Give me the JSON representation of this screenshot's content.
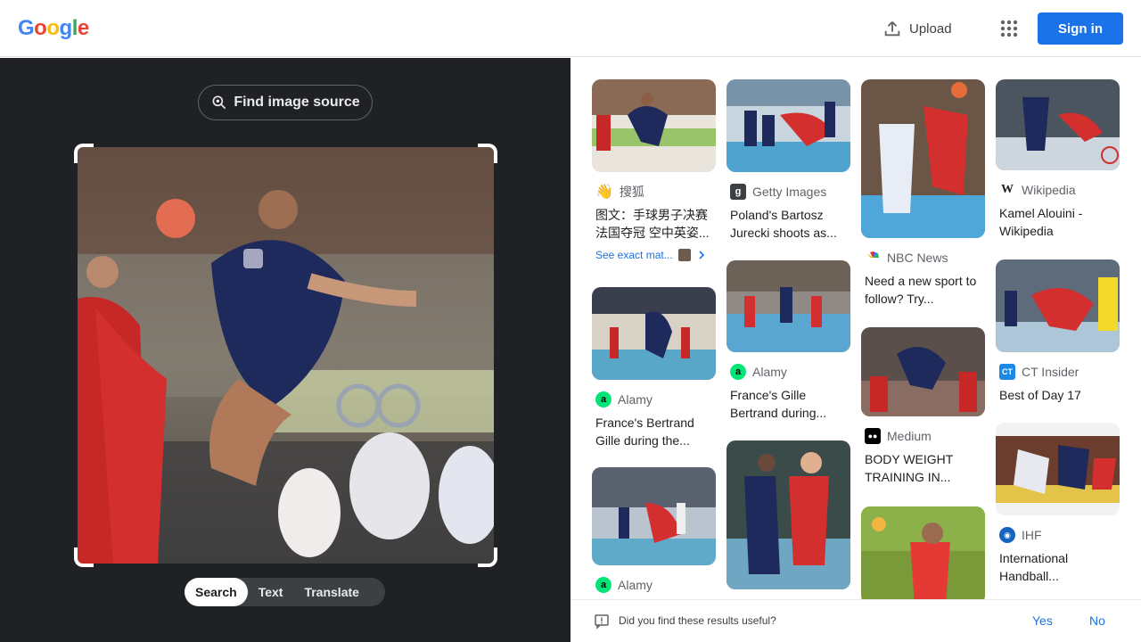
{
  "header": {
    "logo_letters": [
      "G",
      "o",
      "o",
      "g",
      "l",
      "e"
    ],
    "logo_colors": [
      "#4285f4",
      "#ea4335",
      "#fbbc05",
      "#4285f4",
      "#34a853",
      "#ea4335"
    ],
    "upload_label": "Upload",
    "signin_label": "Sign in"
  },
  "query": {
    "find_source_label": "Find image source",
    "modes": [
      "Search",
      "Text",
      "Translate"
    ],
    "active_mode": "Search"
  },
  "results": [
    {
      "source": "搜狐",
      "icon": "sohu-icon",
      "icon_color": "#f5b400",
      "title": "图文：手球男子决赛 法国夺冠 空中英姿...",
      "exact": "See exact mat..."
    },
    {
      "source": "Alamy",
      "icon": "alamy-icon",
      "icon_color": "#00e676",
      "title": "France's Bertrand Gille during the..."
    },
    {
      "source": "Alamy",
      "icon": "alamy-icon",
      "icon_color": "#00e676",
      "title": ""
    },
    {
      "source": "Getty Images",
      "icon": "getty-icon",
      "icon_color": "#3c4043",
      "title": "Poland's Bartosz Jurecki shoots as..."
    },
    {
      "source": "Alamy",
      "icon": "alamy-icon",
      "icon_color": "#00e676",
      "title": "France's Gille Bertrand during..."
    },
    {
      "source": "",
      "icon": "",
      "icon_color": "",
      "title": ""
    },
    {
      "source": "NBC News",
      "icon": "nbc-icon",
      "icon_color": "#e53935",
      "title": "Need a new sport to follow? Try..."
    },
    {
      "source": "Medium",
      "icon": "medium-icon",
      "icon_color": "#000000",
      "title": "BODY WEIGHT TRAINING IN..."
    },
    {
      "source": "",
      "icon": "",
      "icon_color": "",
      "title": ""
    },
    {
      "source": "Wikipedia",
      "icon": "wikipedia-icon",
      "icon_color": "#ffffff",
      "title": "Kamel Alouini - Wikipedia"
    },
    {
      "source": "CT Insider",
      "icon": "ctinsider-icon",
      "icon_color": "#1e88e5",
      "title": "Best of Day 17"
    },
    {
      "source": "IHF",
      "icon": "ihf-icon",
      "icon_color": "#1565c0",
      "title": "International Handball..."
    }
  ],
  "feedback": {
    "question": "Did you find these results useful?",
    "yes": "Yes",
    "no": "No"
  }
}
